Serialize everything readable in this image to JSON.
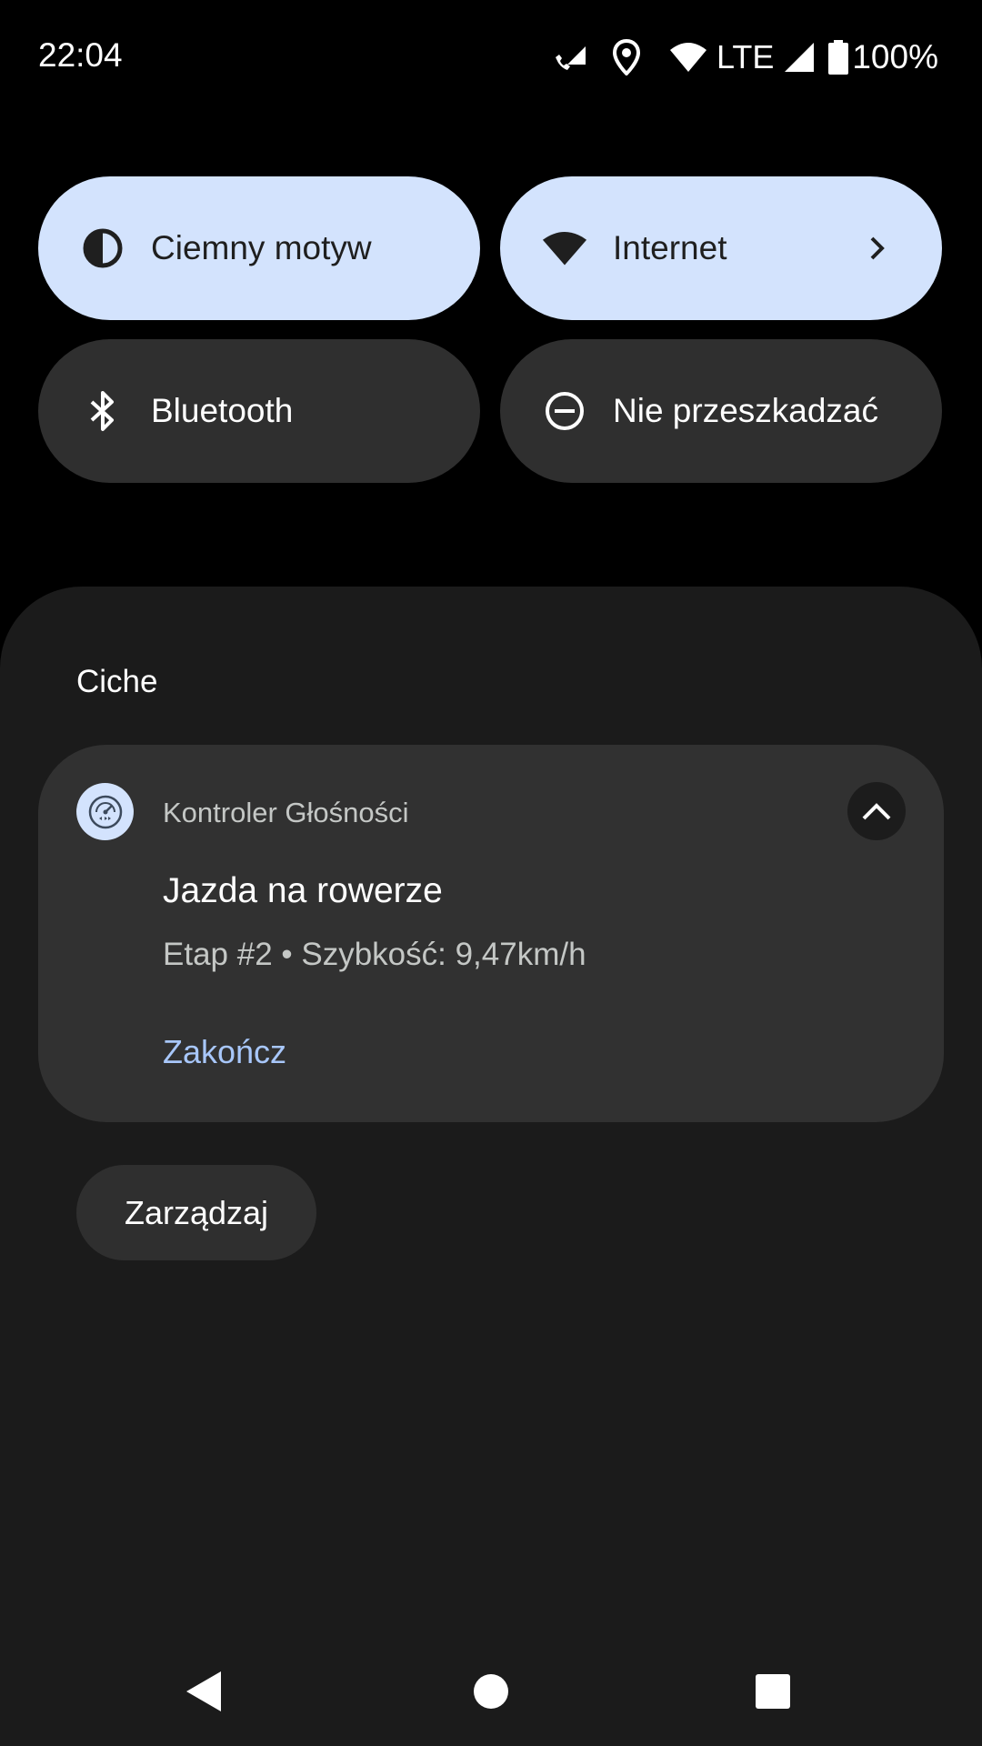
{
  "status_bar": {
    "time": "22:04",
    "network_type": "LTE",
    "battery_percent": "100%",
    "icons": [
      "wifi-calling-icon",
      "location-icon",
      "wifi-icon",
      "signal-icon",
      "battery-icon"
    ]
  },
  "quick_settings": {
    "tiles": [
      {
        "label": "Ciemny motyw",
        "icon": "dark-theme-icon",
        "state": "on"
      },
      {
        "label": "Internet",
        "icon": "wifi-icon",
        "state": "on"
      },
      {
        "label": "Bluetooth",
        "icon": "bluetooth-icon",
        "state": "off"
      },
      {
        "label": "Nie przeszkadzać",
        "icon": "do-not-disturb-icon",
        "state": "off"
      }
    ]
  },
  "notifications": {
    "section_header": "Ciche",
    "items": [
      {
        "app_name": "Kontroler Głośności",
        "title": "Jazda na rowerze",
        "text": "Etap #2 • Szybkość: 9,47km/h",
        "action_label": "Zakończ",
        "expanded": true
      }
    ],
    "manage_label": "Zarządzaj"
  },
  "colors": {
    "tile_on_bg": "#d3e3fd",
    "tile_off_bg": "#2f2f2f",
    "shade_bg": "#1b1b1b",
    "card_bg": "#313131",
    "action_accent": "#a8c7fa"
  }
}
